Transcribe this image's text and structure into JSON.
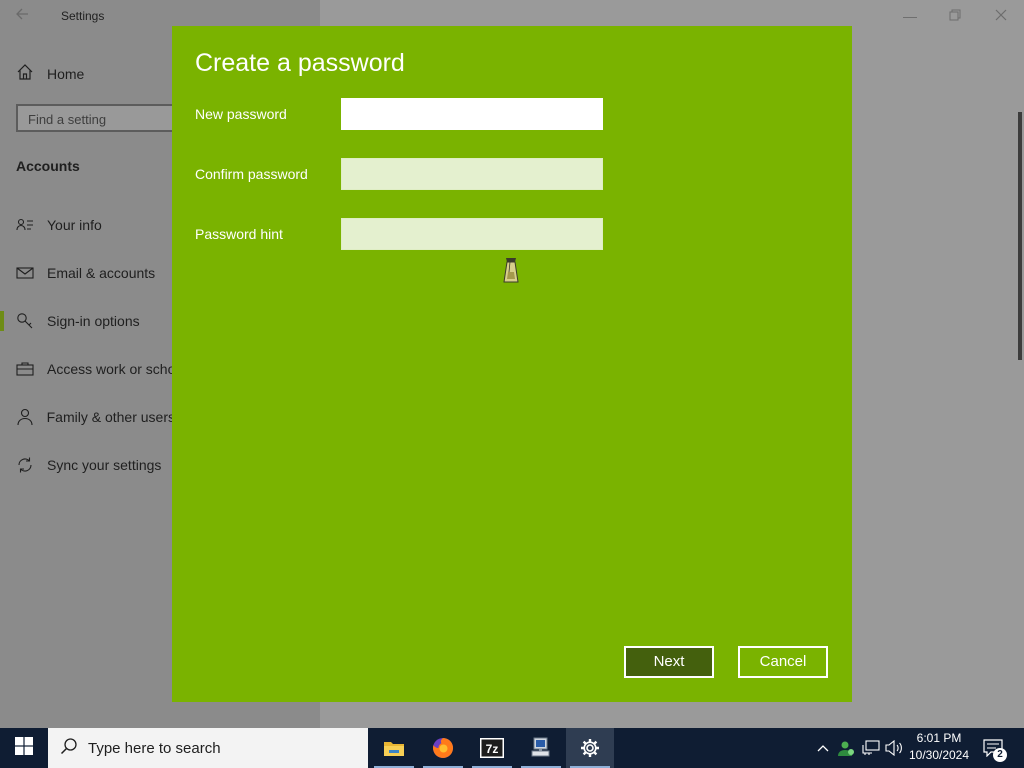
{
  "window": {
    "title": "Settings",
    "back_icon": "back-arrow-icon",
    "controls": [
      "minimize-icon",
      "maximize-icon",
      "close-icon"
    ]
  },
  "sidebar": {
    "home_label": "Home",
    "search_placeholder": "Find a setting",
    "section_heading": "Accounts",
    "items": [
      {
        "label": "Your info",
        "icon": "person-card-icon",
        "selected": false
      },
      {
        "label": "Email & accounts",
        "icon": "mail-icon",
        "selected": false
      },
      {
        "label": "Sign-in options",
        "icon": "key-icon",
        "selected": true
      },
      {
        "label": "Access work or scho",
        "icon": "briefcase-icon",
        "selected": false
      },
      {
        "label": "Family & other users",
        "icon": "person-icon",
        "selected": false
      },
      {
        "label": "Sync your settings",
        "icon": "sync-icon",
        "selected": false
      }
    ]
  },
  "dialog": {
    "title": "Create a password",
    "fields": [
      {
        "label": "New password",
        "value": ""
      },
      {
        "label": "Confirm password",
        "value": ""
      },
      {
        "label": "Password hint",
        "value": ""
      }
    ],
    "next_label": "Next",
    "cancel_label": "Cancel"
  },
  "taskbar": {
    "search_placeholder": "Type here to search",
    "apps": [
      "file-explorer-icon",
      "firefox-icon",
      "7zip-icon",
      "network-computer-icon",
      "settings-gear-icon"
    ],
    "time": "6:01 PM",
    "date": "10/30/2024",
    "notification_count": "2"
  },
  "colors": {
    "dialog_background": "#7ab300",
    "next_button": "#44600d",
    "taskbar": "#0f1d33",
    "accent_selection": "#6e8c15"
  }
}
